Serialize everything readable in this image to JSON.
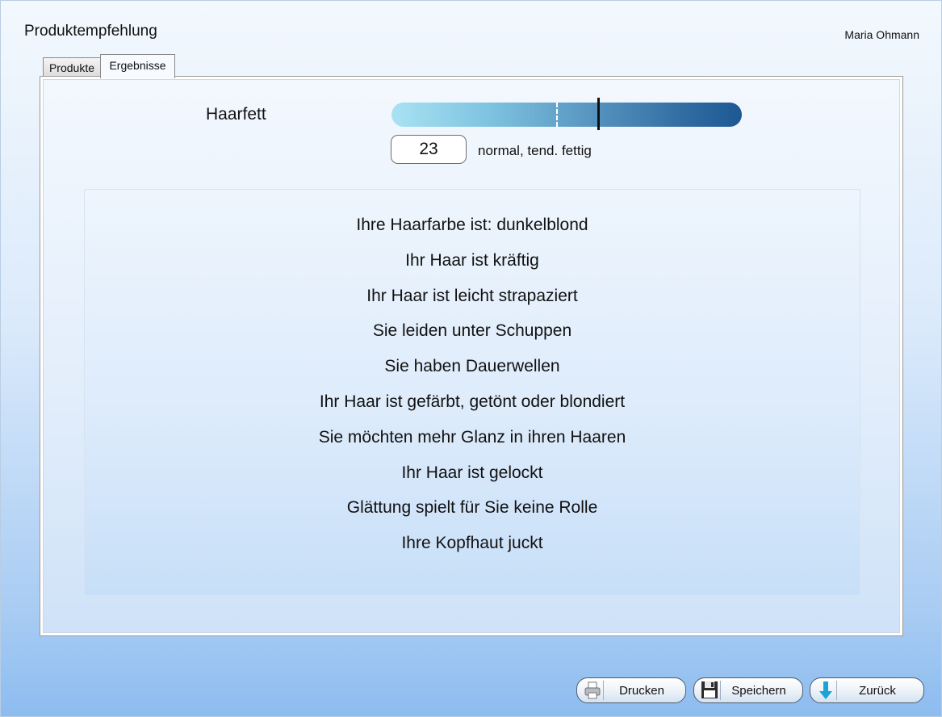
{
  "header": {
    "title": "Produktempfehlung",
    "user": "Maria Ohmann"
  },
  "tabs": [
    {
      "label": "Produkte",
      "active": false
    },
    {
      "label": "Ergebnisse",
      "active": true
    }
  ],
  "metric": {
    "label": "Haarfett",
    "value": "23",
    "description": "normal, tend. fettig",
    "gauge_level": 0.59,
    "gauge_reference": 0.47,
    "gauge_colors": [
      "#a9e2f3",
      "#1d5894"
    ]
  },
  "results": [
    "Ihre Haarfarbe ist: dunkelblond",
    "Ihr Haar ist kräftig",
    "Ihr Haar ist leicht strapaziert",
    "Sie leiden unter Schuppen",
    "Sie haben Dauerwellen",
    "Ihr Haar ist gefärbt, getönt oder blondiert",
    "Sie möchten mehr Glanz in ihren Haaren",
    "Ihr Haar ist gelockt",
    "Glättung spielt für Sie keine Rolle",
    "Ihre Kopfhaut juckt"
  ],
  "footer": {
    "buttons": [
      {
        "label": "Drucken",
        "icon": "printer-icon"
      },
      {
        "label": "Speichern",
        "icon": "save-icon"
      },
      {
        "label": "Zurück",
        "icon": "arrow-down-icon"
      }
    ]
  }
}
